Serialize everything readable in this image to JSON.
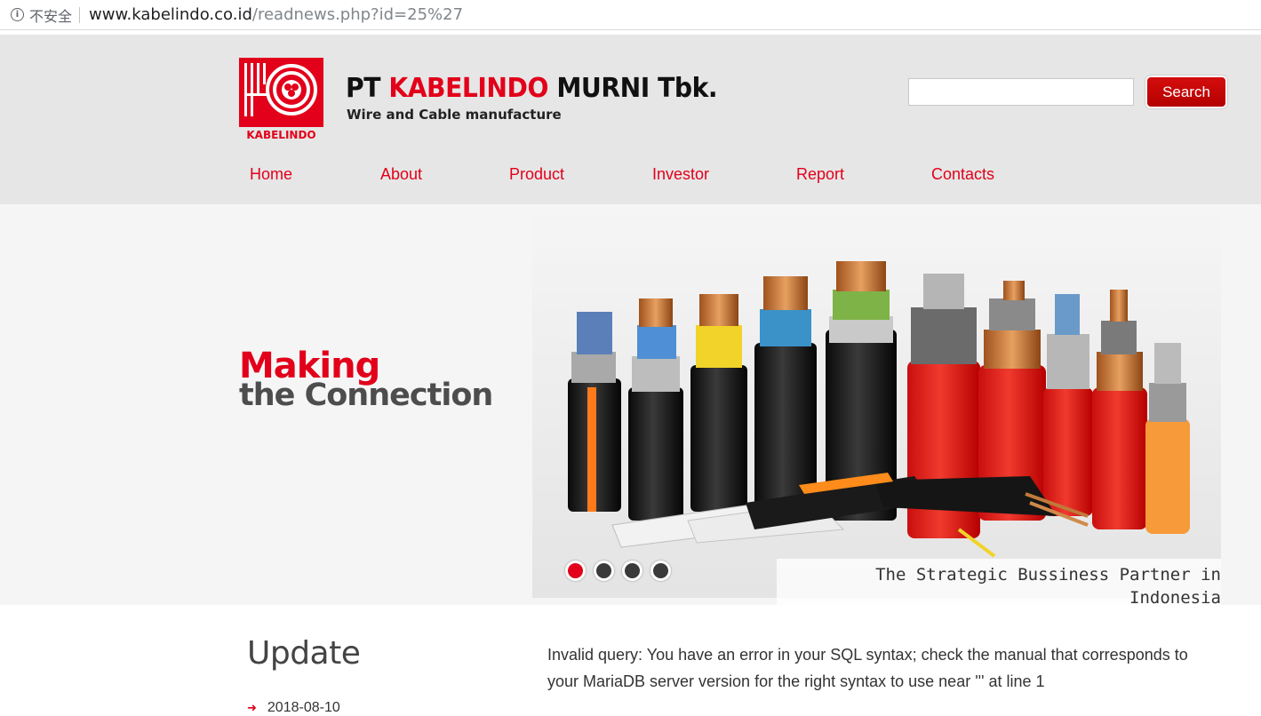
{
  "browser": {
    "security_label": "不安全",
    "url_host": "www.kabelindo.co.id",
    "url_path": "/readnews.php?id=25%27"
  },
  "header": {
    "logo_text": "KABELINDO",
    "brand_prefix": "PT ",
    "brand_highlight": "KABELINDO",
    "brand_suffix": " MURNI Tbk.",
    "tagline": "Wire and Cable manufacture",
    "search_value": "",
    "search_button": "Search"
  },
  "nav": {
    "items": [
      {
        "label": "Home"
      },
      {
        "label": "About"
      },
      {
        "label": "Product"
      },
      {
        "label": "Investor"
      },
      {
        "label": "Report"
      },
      {
        "label": "Contacts"
      }
    ]
  },
  "hero": {
    "line1": "Making",
    "line2": "the Connection",
    "caption": "The Strategic Bussiness Partner in Indonesia",
    "slides": 4,
    "active_slide": 1
  },
  "main": {
    "update_title": "Update",
    "news": [
      {
        "date": "2018-08-10"
      }
    ],
    "error_message": "Invalid query: You have an error in your SQL syntax; check the manual that corresponds to your MariaDB server version for the right syntax to use near ''' at line 1"
  },
  "colors": {
    "brand_red": "#e2001a",
    "header_bg": "#e6e6e6",
    "hero_bg": "#f5f5f5"
  }
}
